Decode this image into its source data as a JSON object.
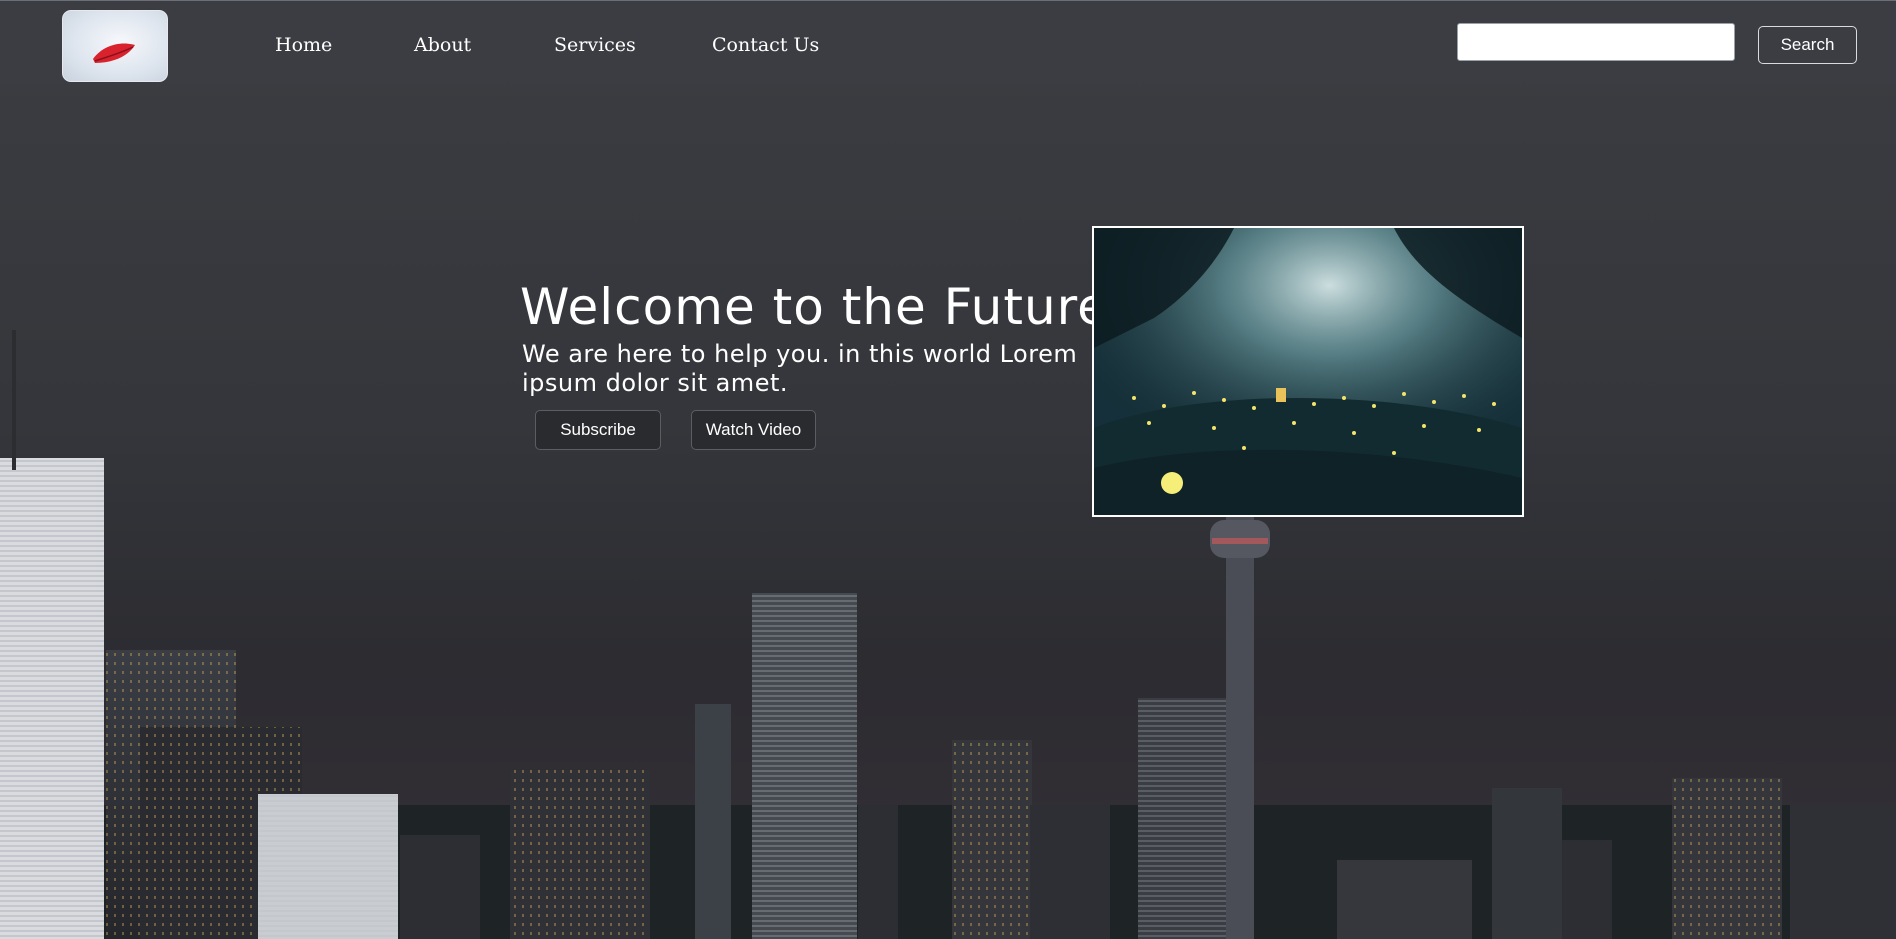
{
  "nav": {
    "links": [
      "Home",
      "About",
      "Services",
      "Contact Us"
    ]
  },
  "search": {
    "placeholder": "",
    "value": "",
    "button_label": "Search"
  },
  "hero": {
    "title": "Welcome to the Future",
    "subtitle": "We are here to help you. in this world Lorem ipsum dolor sit amet.",
    "buttons": [
      "Subscribe",
      "Watch Video"
    ]
  },
  "colors": {
    "background": "#36383d",
    "button_bg": "#2a2b2f",
    "text": "#ffffff"
  },
  "icons": {
    "logo": "red-leaf-logo-icon"
  }
}
